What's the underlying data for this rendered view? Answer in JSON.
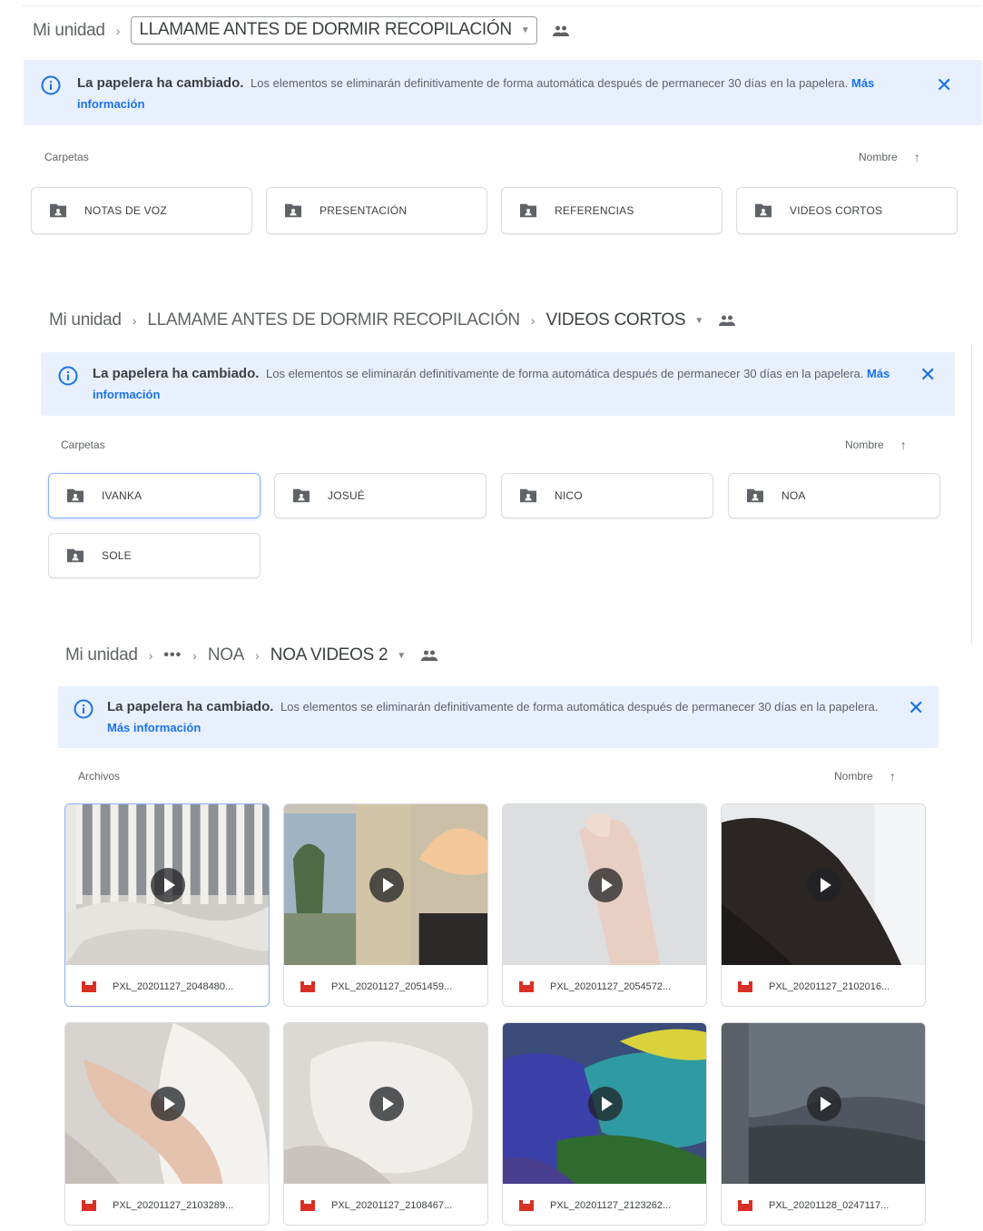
{
  "panels": [
    {
      "breadcrumb": {
        "root": "Mi unidad",
        "current": "LLAMAME ANTES DE DORMIR RECOPILACIÓN"
      },
      "banner": {
        "title": "La papelera ha cambiado.",
        "body": "Los elementos se eliminarán definitivamente de forma automática después de permanecer 30 días en la papelera.",
        "link": "Más información"
      },
      "section_label": "Carpetas",
      "sort_label": "Nombre",
      "folders": [
        "NOTAS DE VOZ",
        "PRESENTACIÓN",
        "REFERENCIAS",
        "VIDEOS CORTOS"
      ]
    },
    {
      "breadcrumb": {
        "root": "Mi unidad",
        "middle": "LLAMAME ANTES DE DORMIR RECOPILACIÓN",
        "current": "VIDEOS CORTOS"
      },
      "banner": {
        "title": "La papelera ha cambiado.",
        "body": "Los elementos se eliminarán definitivamente de forma automática después de permanecer 30 días en la papelera.",
        "link": "Más información"
      },
      "section_label": "Carpetas",
      "sort_label": "Nombre",
      "folders": [
        "IVANKA",
        "JOSUÉ",
        "NICO",
        "NOA",
        "SOLE"
      ]
    },
    {
      "breadcrumb": {
        "root": "Mi unidad",
        "ellipsis": "•••",
        "middle": "NOA",
        "current": "NOA VIDEOS 2"
      },
      "banner": {
        "title": "La papelera ha cambiado.",
        "body": "Los elementos se eliminarán definitivamente de forma automática después de permanecer 30 días en la papelera.",
        "link": "Más información"
      },
      "section_label": "Archivos",
      "sort_label": "Nombre",
      "files": [
        "PXL_20201127_2048480...",
        "PXL_20201127_2051459...",
        "PXL_20201127_2054572...",
        "PXL_20201127_2102016...",
        "PXL_20201127_2103289...",
        "PXL_20201127_2108467...",
        "PXL_20201127_2123262...",
        "PXL_20201128_0247117..."
      ]
    }
  ],
  "icons": {
    "info": "info-circle-icon",
    "close": "close-icon",
    "people": "shared-people-icon",
    "folder": "shared-folder-icon",
    "sort": "arrow-up-icon",
    "play": "play-icon",
    "video": "video-file-icon"
  },
  "colors": {
    "accent": "#1a73e8",
    "banner_bg": "#e8f0fe",
    "video_icon": "#d93025",
    "selected_border": "#8ab4f8"
  }
}
